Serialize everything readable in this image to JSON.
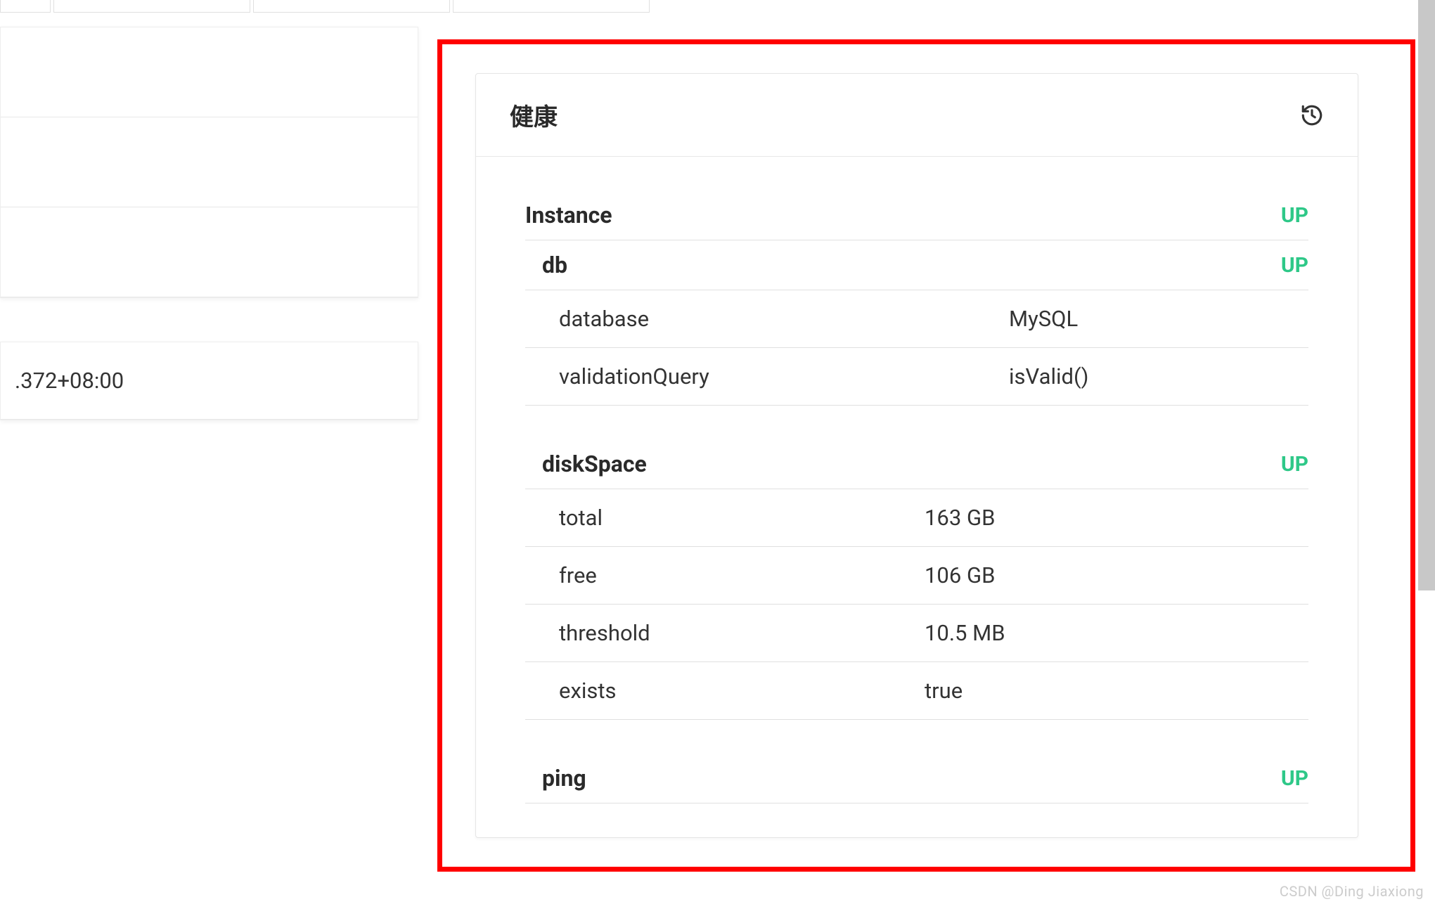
{
  "left": {
    "timestamp_fragment": ".372+08:00"
  },
  "card": {
    "title": "健康"
  },
  "health": {
    "instance": {
      "label": "Instance",
      "status": "UP"
    },
    "db": {
      "label": "db",
      "status": "UP",
      "details": {
        "database_key": "database",
        "database_value": "MySQL",
        "validationQuery_key": "validationQuery",
        "validationQuery_value": "isValid()"
      }
    },
    "diskSpace": {
      "label": "diskSpace",
      "status": "UP",
      "details": {
        "total_key": "total",
        "total_value": "163 GB",
        "free_key": "free",
        "free_value": "106 GB",
        "threshold_key": "threshold",
        "threshold_value": "10.5 MB",
        "exists_key": "exists",
        "exists_value": "true"
      }
    },
    "ping": {
      "label": "ping",
      "status": "UP"
    }
  },
  "watermark": "CSDN @Ding Jiaxiong"
}
